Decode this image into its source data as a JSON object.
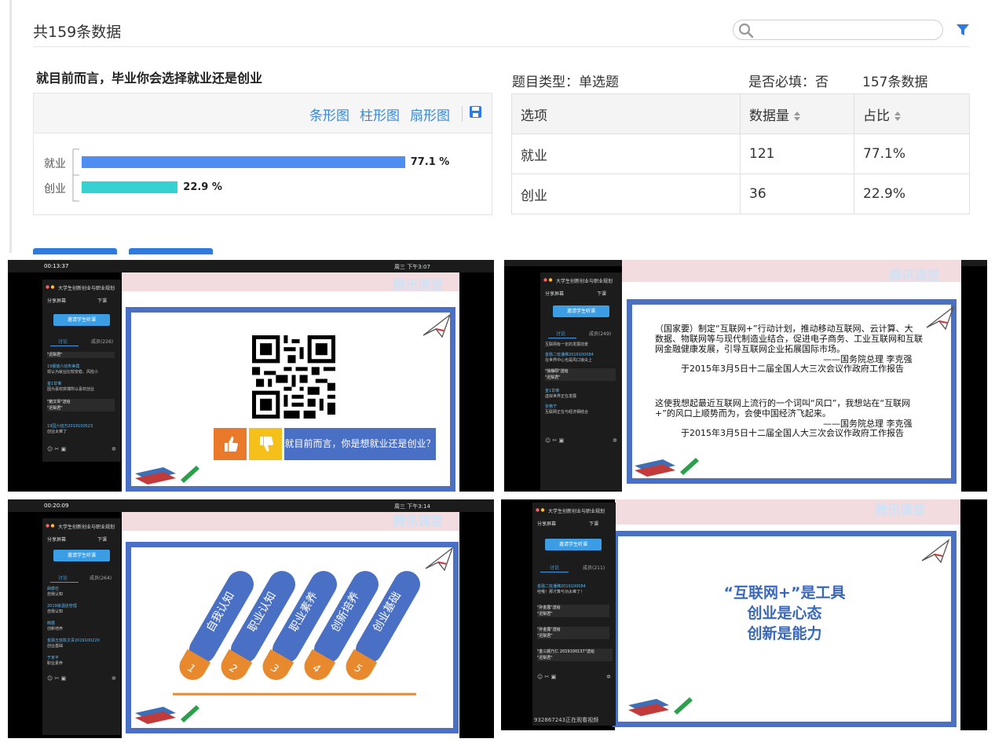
{
  "summary": {
    "total": "共159条数据"
  },
  "question": {
    "title": "就目前而言，毕业你会选择就业还是创业",
    "type": "题目类型：单选题",
    "required": "是否必填：否",
    "count": "157条数据"
  },
  "chart_tools": {
    "bar_h": "条形图",
    "bar_v": "柱形图",
    "pie": "扇形图"
  },
  "chart_data": {
    "type": "bar",
    "orientation": "horizontal",
    "categories": [
      "就业",
      "创业"
    ],
    "values": [
      77.1,
      22.9
    ],
    "value_labels": [
      "77.1 %",
      "22.9 %"
    ],
    "colors": [
      "#4d8ef0",
      "#36d1d1"
    ],
    "xlim": [
      0,
      100
    ]
  },
  "table": {
    "headers": [
      "选项",
      "数据量",
      "占比"
    ],
    "rows": [
      [
        "就业",
        "121",
        "77.1%"
      ],
      [
        "创业",
        "36",
        "22.9%"
      ]
    ]
  },
  "colors": {
    "accent": "#3a87d8",
    "frame": "#4a70c6"
  },
  "shots": {
    "app_title": "大学生创新创业与职业规划",
    "share": "分享屏幕",
    "end": "下课",
    "invite": "邀请学生听课",
    "tab_discuss": "讨论",
    "logo": "腾讯课堂",
    "s1": {
      "time": "00:13:37",
      "clock": "周三 下午3:07",
      "members": "成员(226)",
      "banner": "就目前而言，你是想就业还是创业？",
      "msgs": [
        {
          "name": "\"迟梨君\"",
          "text": ""
        },
        {
          "name": "19服装六班朱美霞",
          "text": "现认为就业比较安稳、风险小"
        },
        {
          "name": "金1甘琳",
          "text": "因为喜欢拼搏所以喜欢创业"
        },
        {
          "name": "\"鹅文琴\"送给",
          "text": "\"迟梨君\""
        },
        {
          "name": "19园六班方2019100523",
          "text": "创业太难了"
        }
      ]
    },
    "s2": {
      "members": "成员(249)",
      "quote1": [
        "（国家要）制定“互联网+”行动计划，推动移动互联网、云计算、大",
        "数据、物联网等与现代制造业结合，促进电子商务、工业互联网和互联",
        "网金融健康发展，引导互联网企业拓展国际市场。",
        "——国务院总理 李克强",
        "于2015年3月5日十二届全国人大三次会议作政府工作报告"
      ],
      "quote2": [
        "这使我想起最近互联网上流行的一个词叫“风口”，我想站在“互联网",
        "+”的风口上顺势而为，会使中国经济飞起来。",
        "——国务院总理 李克强",
        "于2015年3月5日十二届全国人大三次会议作政府工作报告"
      ],
      "msgs": [
        {
          "name": "互联网有一定的发展前景",
          "text": ""
        },
        {
          "name": "金融二班潘佛2019100084",
          "text": "在世界中心也是风口浪尖上"
        },
        {
          "name": "\"徐静阳\"送给",
          "text": "\"迟梨君\""
        },
        {
          "name": "金1甘琳",
          "text": "虚拟世界正在发展"
        },
        {
          "name": "张格宁",
          "text": "互联网正在与经济相结合"
        }
      ]
    },
    "s3": {
      "time": "00:20:09",
      "clock": "周三 下午3:14",
      "members": "成员(264)",
      "pills": [
        "自我认知",
        "职业认知",
        "职业素养",
        "创新培养",
        "创业基础"
      ],
      "nums": [
        "1",
        "2",
        "3",
        "4",
        "5"
      ],
      "msgs": [
        {
          "name": "曲康召",
          "text": "自我认知"
        },
        {
          "name": "2019级酒店管理",
          "text": "自我认知"
        },
        {
          "name": "韩露",
          "text": "创新培养"
        },
        {
          "name": "金融五班陈文青2019100220",
          "text": "创业基础"
        },
        {
          "name": "于家平",
          "text": "职业素养"
        }
      ]
    },
    "s4": {
      "members": "成员(211)",
      "lines": [
        "“互联网+”是工具",
        "创业是心态",
        "创新是能力"
      ],
      "viewer": "932867243正在观看视频",
      "msgs": [
        {
          "name": "金融二班潘佛2019100084",
          "text": "哇哦！那才算与功太难了！"
        },
        {
          "name": "\"孙金露\"送给",
          "text": "\"迟梨君\""
        },
        {
          "name": "\"孙金露\"送给",
          "text": "\"迟梨君\""
        },
        {
          "name": "\"金三颜乃仁 2019100137\"送给",
          "text": "\"迟梨君\""
        }
      ]
    }
  }
}
